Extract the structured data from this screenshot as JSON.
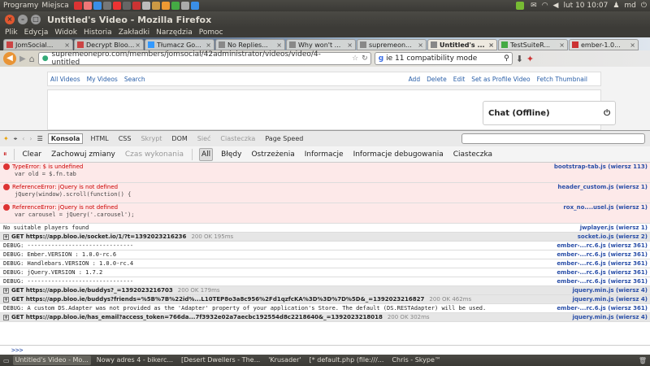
{
  "panel": {
    "menu": "Programy",
    "places": "Miejsca",
    "time": "lut 10 10:07",
    "user": "md"
  },
  "window": {
    "title": "Untitled's Video - Mozilla Firefox"
  },
  "menubar": [
    "Plik",
    "Edycja",
    "Widok",
    "Historia",
    "Zakładki",
    "Narzędzia",
    "Pomoc"
  ],
  "tabs": [
    {
      "label": "JomSocial..."
    },
    {
      "label": "Decrypt Bloo..."
    },
    {
      "label": "Tłumacz Go..."
    },
    {
      "label": "No Replies..."
    },
    {
      "label": "Why won't ..."
    },
    {
      "label": "supremeon..."
    },
    {
      "label": "Untitled's ...",
      "active": true
    },
    {
      "label": "TestSuiteR..."
    },
    {
      "label": "ember-1.0..."
    }
  ],
  "nav": {
    "url": "supremeonepro.com/members/jomsocial/42administrator/videos/video/4-untitled",
    "search": "ie 11 compatibility mode"
  },
  "page": {
    "subnav_left": [
      "All Videos",
      "My Videos",
      "Search"
    ],
    "subnav_right": [
      "Add",
      "Delete",
      "Edit",
      "Set as Profile Video",
      "Fetch Thumbnail"
    ],
    "chat": "Chat (Offline)"
  },
  "firebug": {
    "tabs": [
      "Konsola",
      "HTML",
      "CSS",
      "Skrypt",
      "DOM",
      "Sieć",
      "Ciasteczka",
      "Page Speed"
    ],
    "tools": {
      "clear": "Clear",
      "persist": "Zachowuj zmiany",
      "profile": "Czas wykonania",
      "all": "All",
      "errors": "Błędy",
      "warnings": "Ostrzeżenia",
      "info": "Informacje",
      "debug": "Informacje debugowania",
      "cookies": "Ciasteczka"
    },
    "rows": [
      {
        "type": "err",
        "msg": "TypeError: $ is undefined",
        "code": "var old = $.fn.tab",
        "src": "bootstrap-tab.js (wiersz 113)"
      },
      {
        "type": "err",
        "msg": "ReferenceError: jQuery is not defined",
        "code": "jQuery(window).scroll(function() {",
        "src": "header_custom.js (wiersz 1)"
      },
      {
        "type": "err",
        "msg": "ReferenceError: jQuery is not defined",
        "code": "var carousel = jQuery('.carousel');",
        "src": "rox_no....usel.js (wiersz 1)"
      },
      {
        "type": "log",
        "msg": "No suitable players found",
        "src": "jwplayer.js (wiersz 1)"
      },
      {
        "type": "net",
        "msg": "GET https://app.bloo.ie/socket.io/1/?t=1392023216236",
        "status": "200 OK 195ms",
        "src": "socket.io.js (wiersz 2)"
      },
      {
        "type": "log",
        "msg": "DEBUG: -------------------------------",
        "src": "ember-...rc.6.js (wiersz 361)"
      },
      {
        "type": "log",
        "msg": "DEBUG: Ember.VERSION : 1.0.0-rc.6",
        "src": "ember-...rc.6.js (wiersz 361)"
      },
      {
        "type": "log",
        "msg": "DEBUG: Handlebars.VERSION : 1.0.0-rc.4",
        "src": "ember-...rc.6.js (wiersz 361)"
      },
      {
        "type": "log",
        "msg": "DEBUG: jQuery.VERSION : 1.7.2",
        "src": "ember-...rc.6.js (wiersz 361)"
      },
      {
        "type": "log",
        "msg": "DEBUG: -------------------------------",
        "src": "ember-...rc.6.js (wiersz 361)"
      },
      {
        "type": "net",
        "msg": "GET https://app.bloo.ie/buddys?_=1392023216703",
        "status": "200 OK 179ms",
        "src": "jquery.min.js (wiersz 4)"
      },
      {
        "type": "net",
        "msg": "GET https://app.bloo.ie/buddys?friends=%5B%7B%22id%...L10TEP8o3a8c956%2Fd1qzfcKA%3D%3D%7D%5D&_=1392023216827",
        "status": "200 OK 462ms",
        "src": "jquery.min.js (wiersz 4)"
      },
      {
        "type": "log",
        "msg": "DEBUG: A custom DS.Adapter was not provided as the 'Adapter' property of your application's Store. The default (DS.RESTAdapter) will be used.",
        "src": "ember-...rc.6.js (wiersz 361)"
      },
      {
        "type": "net",
        "msg": "GET https://app.bloo.ie/has_email?access_token=766da...7f3932e02a7aecbc192554d8c2218640&_=1392023218018",
        "status": "200 OK 302ms",
        "src": "jquery.min.js (wiersz 4)"
      }
    ],
    "prompt": ">>>"
  },
  "taskbar": [
    {
      "label": "Untitled's Video - Mo...",
      "active": true
    },
    {
      "label": "Nowy adres 4 - bikerc..."
    },
    {
      "label": "[Desert Dwellers - The..."
    },
    {
      "label": "'Krusader'"
    },
    {
      "label": "[* default.php (file:///..."
    },
    {
      "label": "Chris - Skype™"
    }
  ]
}
